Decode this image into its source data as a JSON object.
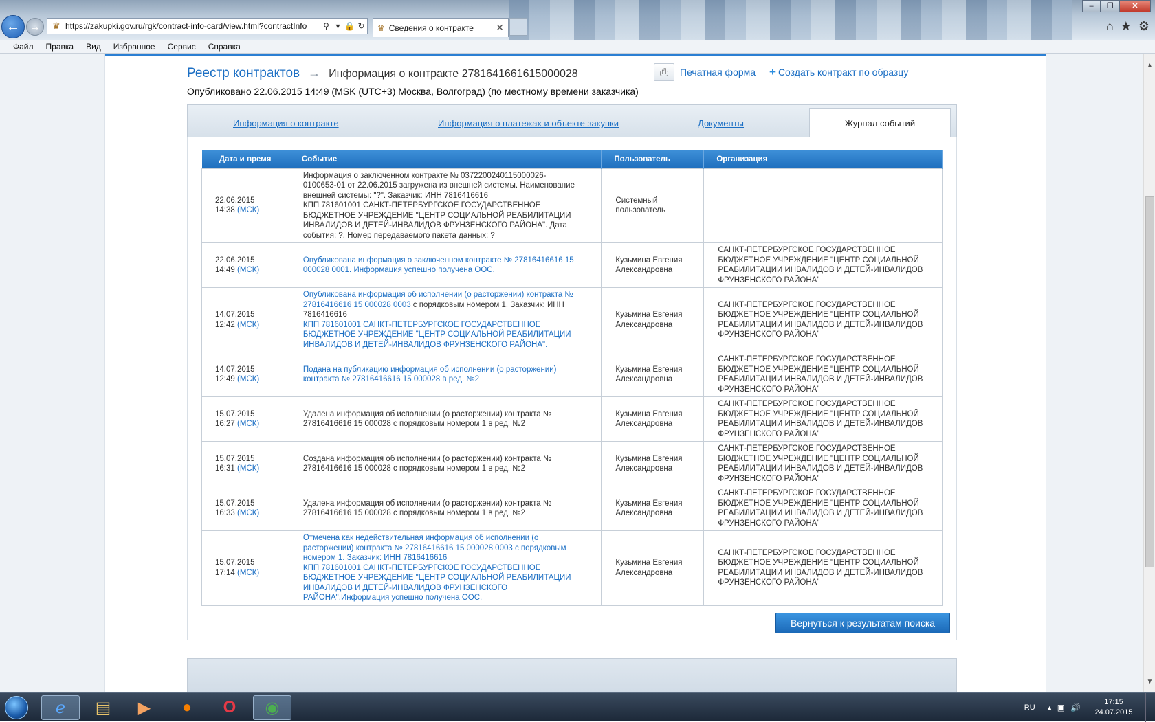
{
  "browser": {
    "url": "https://zakupki.gov.ru/rgk/contract-info-card/view.html?contractInfo",
    "tab_title": "Сведения о контракте",
    "menu": [
      "Файл",
      "Правка",
      "Вид",
      "Избранное",
      "Сервис",
      "Справка"
    ]
  },
  "header": {
    "registry_link": "Реестр контрактов",
    "arrow": "→",
    "current": "Информация о контракте 2781641661615000028",
    "published": "Опубликовано 22.06.2015 14:49 (MSK (UTC+3) Москва, Волгоград) (по местному времени заказчика)",
    "print_label": "Печатная форма",
    "create_label": "Создать контракт по образцу"
  },
  "tabs": {
    "contract_info": "Информация о контракте",
    "payments_info": "Информация о платежах и объекте закупки",
    "documents": "Документы",
    "event_log": "Журнал событий"
  },
  "table": {
    "columns": [
      "Дата и время",
      "Событие",
      "Пользователь",
      "Организация"
    ],
    "rows": [
      {
        "date": "22.06.2015",
        "time": "14:38",
        "tz": "(МСК)",
        "event_lines": [
          "Информация о заключенном контракте № 0372200240115000026-",
          "0100653-01 от 22.06.2015 загружена из внешней системы. Наименование",
          "внешней системы: \"?\". Заказчик: ИНН 7816416616",
          "КПП 781601001 САНКТ-ПЕТЕРБУРГСКОЕ ГОСУДАРСТВЕННОЕ",
          "БЮДЖЕТНОЕ УЧРЕЖДЕНИЕ \"ЦЕНТР СОЦИАЛЬНОЙ РЕАБИЛИТАЦИИ",
          "ИНВАЛИДОВ И ДЕТЕЙ-ИНВАЛИДОВ ФРУНЗЕНСКОГО РАЙОНА\". Дата",
          "события: ?. Номер передаваемого пакета данных: ?"
        ],
        "event_link": false,
        "user_lines": [
          "Системный",
          "пользователь"
        ],
        "org_lines": []
      },
      {
        "date": "22.06.2015",
        "time": "14:49",
        "tz": "(МСК)",
        "event_lines": [
          "Опубликована информация о заключенном контракте № 27816416616 15",
          "000028 0001. Информация успешно получена ООС."
        ],
        "event_link": true,
        "user_lines": [
          "Кузьмина Евгения",
          "Александровна"
        ],
        "org_lines": [
          "САНКТ-ПЕТЕРБУРГСКОЕ ГОСУДАРСТВЕННОЕ",
          "БЮДЖЕТНОЕ УЧРЕЖДЕНИЕ \"ЦЕНТР СОЦИАЛЬНОЙ",
          "РЕАБИЛИТАЦИИ ИНВАЛИДОВ И ДЕТЕЙ-ИНВАЛИДОВ",
          "ФРУНЗЕНСКОГО РАЙОНА\""
        ]
      },
      {
        "date": "14.07.2015",
        "time": "12:42",
        "tz": "(МСК)",
        "event_lines_mixed": [
          [
            {
              "t": "Опубликована информация об исполнении (о расторжении) контракта №",
              "l": true
            }
          ],
          [
            {
              "t": "27816416616 15 000028 0003",
              "l": true
            },
            {
              "t": " с порядковым номером 1. Заказчик: ИНН",
              "l": false
            }
          ],
          [
            {
              "t": "7816416616",
              "l": false
            }
          ],
          [
            {
              "t": "КПП 781601001 САНКТ-ПЕТЕРБУРГСКОЕ ГОСУДАРСТВЕННОЕ",
              "l": true
            }
          ],
          [
            {
              "t": "БЮДЖЕТНОЕ УЧРЕЖДЕНИЕ \"ЦЕНТР СОЦИАЛЬНОЙ РЕАБИЛИТАЦИИ",
              "l": true
            }
          ],
          [
            {
              "t": "ИНВАЛИДОВ И ДЕТЕЙ-ИНВАЛИДОВ ФРУНЗЕНСКОГО РАЙОНА\".",
              "l": true
            }
          ]
        ],
        "user_lines": [
          "Кузьмина Евгения",
          "Александровна"
        ],
        "org_lines": [
          "САНКТ-ПЕТЕРБУРГСКОЕ ГОСУДАРСТВЕННОЕ",
          "БЮДЖЕТНОЕ УЧРЕЖДЕНИЕ \"ЦЕНТР СОЦИАЛЬНОЙ",
          "РЕАБИЛИТАЦИИ ИНВАЛИДОВ И ДЕТЕЙ-ИНВАЛИДОВ",
          "ФРУНЗЕНСКОГО РАЙОНА\""
        ]
      },
      {
        "date": "14.07.2015",
        "time": "12:49",
        "tz": "(МСК)",
        "event_lines": [
          "Подана на публикацию информация об исполнении (о расторжении)",
          "контракта № 27816416616 15 000028 в ред. №2"
        ],
        "event_link": true,
        "user_lines": [
          "Кузьмина Евгения",
          "Александровна"
        ],
        "org_lines": [
          "САНКТ-ПЕТЕРБУРГСКОЕ ГОСУДАРСТВЕННОЕ",
          "БЮДЖЕТНОЕ УЧРЕЖДЕНИЕ \"ЦЕНТР СОЦИАЛЬНОЙ",
          "РЕАБИЛИТАЦИИ ИНВАЛИДОВ И ДЕТЕЙ-ИНВАЛИДОВ",
          "ФРУНЗЕНСКОГО РАЙОНА\""
        ]
      },
      {
        "date": "15.07.2015",
        "time": "16:27",
        "tz": "(МСК)",
        "event_lines": [
          "Удалена информация об исполнении (о расторжении) контракта №",
          "27816416616 15 000028 с порядковым номером 1 в ред. №2"
        ],
        "event_link": false,
        "user_lines": [
          "Кузьмина Евгения",
          "Александровна"
        ],
        "org_lines": [
          "САНКТ-ПЕТЕРБУРГСКОЕ ГОСУДАРСТВЕННОЕ",
          "БЮДЖЕТНОЕ УЧРЕЖДЕНИЕ \"ЦЕНТР СОЦИАЛЬНОЙ",
          "РЕАБИЛИТАЦИИ ИНВАЛИДОВ И ДЕТЕЙ-ИНВАЛИДОВ",
          "ФРУНЗЕНСКОГО РАЙОНА\""
        ]
      },
      {
        "date": "15.07.2015",
        "time": "16:31",
        "tz": "(МСК)",
        "event_lines": [
          "Создана информация об исполнении (о расторжении) контракта №",
          "27816416616 15 000028 с порядковым номером 1 в ред. №2"
        ],
        "event_link": false,
        "user_lines": [
          "Кузьмина Евгения",
          "Александровна"
        ],
        "org_lines": [
          "САНКТ-ПЕТЕРБУРГСКОЕ ГОСУДАРСТВЕННОЕ",
          "БЮДЖЕТНОЕ УЧРЕЖДЕНИЕ \"ЦЕНТР СОЦИАЛЬНОЙ",
          "РЕАБИЛИТАЦИИ ИНВАЛИДОВ И ДЕТЕЙ-ИНВАЛИДОВ",
          "ФРУНЗЕНСКОГО РАЙОНА\""
        ]
      },
      {
        "date": "15.07.2015",
        "time": "16:33",
        "tz": "(МСК)",
        "event_lines": [
          "Удалена информация об исполнении (о расторжении) контракта №",
          "27816416616 15 000028 с порядковым номером 1 в ред. №2"
        ],
        "event_link": false,
        "user_lines": [
          "Кузьмина Евгения",
          "Александровна"
        ],
        "org_lines": [
          "САНКТ-ПЕТЕРБУРГСКОЕ ГОСУДАРСТВЕННОЕ",
          "БЮДЖЕТНОЕ УЧРЕЖДЕНИЕ \"ЦЕНТР СОЦИАЛЬНОЙ",
          "РЕАБИЛИТАЦИИ ИНВАЛИДОВ И ДЕТЕЙ-ИНВАЛИДОВ",
          "ФРУНЗЕНСКОГО РАЙОНА\""
        ]
      },
      {
        "date": "15.07.2015",
        "time": "17:14",
        "tz": "(МСК)",
        "event_lines": [
          "Отмечена как недействительная информация об исполнении (о",
          "расторжении) контракта № 27816416616 15 000028 0003 с порядковым",
          "номером 1. Заказчик: ИНН 7816416616",
          "КПП 781601001 САНКТ-ПЕТЕРБУРГСКОЕ ГОСУДАРСТВЕННОЕ",
          "БЮДЖЕТНОЕ УЧРЕЖДЕНИЕ \"ЦЕНТР СОЦИАЛЬНОЙ РЕАБИЛИТАЦИИ",
          "ИНВАЛИДОВ И ДЕТЕЙ-ИНВАЛИДОВ ФРУНЗЕНСКОГО",
          "РАЙОНА\".Информация успешно получена ООС."
        ],
        "event_link": true,
        "user_lines": [
          "Кузьмина Евгения",
          "Александровна"
        ],
        "org_lines": [
          "САНКТ-ПЕТЕРБУРГСКОЕ ГОСУДАРСТВЕННОЕ",
          "БЮДЖЕТНОЕ УЧРЕЖДЕНИЕ \"ЦЕНТР СОЦИАЛЬНОЙ",
          "РЕАБИЛИТАЦИИ ИНВАЛИДОВ И ДЕТЕЙ-ИНВАЛИДОВ",
          "ФРУНЗЕНСКОГО РАЙОНА\""
        ]
      }
    ]
  },
  "footer": {
    "back_label": "Вернуться к результатам поиска"
  },
  "taskbar": {
    "lang": "RU",
    "time": "17:15",
    "date": "24.07.2015"
  },
  "colors": {
    "accent": "#1c6fc4",
    "header_blue": "#2b7fd3"
  }
}
